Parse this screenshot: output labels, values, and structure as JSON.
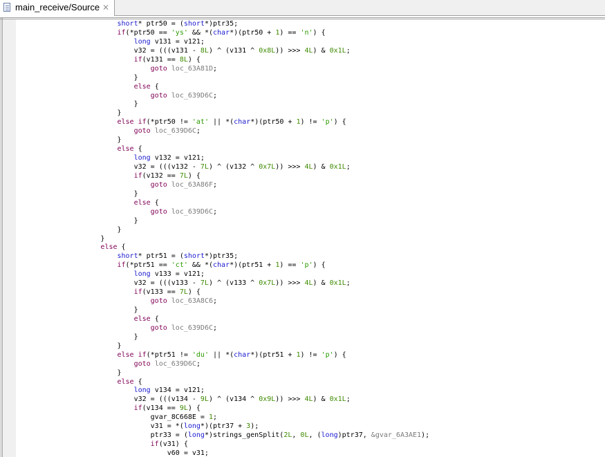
{
  "tab": {
    "title": "main_receive/Source",
    "icon": "source-file-icon",
    "close_icon": "close-icon"
  },
  "colors": {
    "keyword": "#7f0055",
    "type": "#1a1ad0",
    "string": "#2a9a00",
    "number": "#3d8a00",
    "label": "#7a7a7a"
  },
  "code_lines": [
    [
      [
        "p",
        "                        "
      ],
      [
        "t",
        "short"
      ],
      [
        "p",
        "* ptr50 = ("
      ],
      [
        "t",
        "short"
      ],
      [
        "p",
        "*)ptr35;"
      ]
    ],
    [
      [
        "p",
        "                        "
      ],
      [
        "k",
        "if"
      ],
      [
        "p",
        "(*ptr50 == "
      ],
      [
        "s",
        "'ys'"
      ],
      [
        "p",
        " && *("
      ],
      [
        "t",
        "char"
      ],
      [
        "p",
        "*)(ptr50 + "
      ],
      [
        "n",
        "1"
      ],
      [
        "p",
        ") == "
      ],
      [
        "s",
        "'n'"
      ],
      [
        "p",
        ") {"
      ]
    ],
    [
      [
        "p",
        "                            "
      ],
      [
        "t",
        "long"
      ],
      [
        "p",
        " v131 = v121;"
      ]
    ],
    [
      [
        "p",
        "                            v32 = (((v131 - "
      ],
      [
        "n",
        "8L"
      ],
      [
        "p",
        ") ^ (v131 ^ "
      ],
      [
        "n",
        "0x8L"
      ],
      [
        "p",
        ")) >>> "
      ],
      [
        "n",
        "4L"
      ],
      [
        "p",
        ") & "
      ],
      [
        "n",
        "0x1L"
      ],
      [
        "p",
        ";"
      ]
    ],
    [
      [
        "p",
        "                            "
      ],
      [
        "k",
        "if"
      ],
      [
        "p",
        "(v131 == "
      ],
      [
        "n",
        "8L"
      ],
      [
        "p",
        ") {"
      ]
    ],
    [
      [
        "p",
        "                                "
      ],
      [
        "k",
        "goto"
      ],
      [
        "p",
        " "
      ],
      [
        "l",
        "loc_63A81D"
      ],
      [
        "p",
        ";"
      ]
    ],
    [
      [
        "p",
        "                            }"
      ]
    ],
    [
      [
        "p",
        "                            "
      ],
      [
        "k",
        "else"
      ],
      [
        "p",
        " {"
      ]
    ],
    [
      [
        "p",
        "                                "
      ],
      [
        "k",
        "goto"
      ],
      [
        "p",
        " "
      ],
      [
        "l",
        "loc_639D6C"
      ],
      [
        "p",
        ";"
      ]
    ],
    [
      [
        "p",
        "                            }"
      ]
    ],
    [
      [
        "p",
        "                        }"
      ]
    ],
    [
      [
        "p",
        "                        "
      ],
      [
        "k",
        "else if"
      ],
      [
        "p",
        "(*ptr50 != "
      ],
      [
        "s",
        "'at'"
      ],
      [
        "p",
        " || *("
      ],
      [
        "t",
        "char"
      ],
      [
        "p",
        "*)(ptr50 + "
      ],
      [
        "n",
        "1"
      ],
      [
        "p",
        ") != "
      ],
      [
        "s",
        "'p'"
      ],
      [
        "p",
        ") {"
      ]
    ],
    [
      [
        "p",
        "                            "
      ],
      [
        "k",
        "goto"
      ],
      [
        "p",
        " "
      ],
      [
        "l",
        "loc_639D6C"
      ],
      [
        "p",
        ";"
      ]
    ],
    [
      [
        "p",
        "                        }"
      ]
    ],
    [
      [
        "p",
        "                        "
      ],
      [
        "k",
        "else"
      ],
      [
        "p",
        " {"
      ]
    ],
    [
      [
        "p",
        "                            "
      ],
      [
        "t",
        "long"
      ],
      [
        "p",
        " v132 = v121;"
      ]
    ],
    [
      [
        "p",
        "                            v32 = (((v132 - "
      ],
      [
        "n",
        "7L"
      ],
      [
        "p",
        ") ^ (v132 ^ "
      ],
      [
        "n",
        "0x7L"
      ],
      [
        "p",
        ")) >>> "
      ],
      [
        "n",
        "4L"
      ],
      [
        "p",
        ") & "
      ],
      [
        "n",
        "0x1L"
      ],
      [
        "p",
        ";"
      ]
    ],
    [
      [
        "p",
        "                            "
      ],
      [
        "k",
        "if"
      ],
      [
        "p",
        "(v132 == "
      ],
      [
        "n",
        "7L"
      ],
      [
        "p",
        ") {"
      ]
    ],
    [
      [
        "p",
        "                                "
      ],
      [
        "k",
        "goto"
      ],
      [
        "p",
        " "
      ],
      [
        "l",
        "loc_63A86F"
      ],
      [
        "p",
        ";"
      ]
    ],
    [
      [
        "p",
        "                            }"
      ]
    ],
    [
      [
        "p",
        "                            "
      ],
      [
        "k",
        "else"
      ],
      [
        "p",
        " {"
      ]
    ],
    [
      [
        "p",
        "                                "
      ],
      [
        "k",
        "goto"
      ],
      [
        "p",
        " "
      ],
      [
        "l",
        "loc_639D6C"
      ],
      [
        "p",
        ";"
      ]
    ],
    [
      [
        "p",
        "                            }"
      ]
    ],
    [
      [
        "p",
        "                        }"
      ]
    ],
    [
      [
        "p",
        "                    }"
      ]
    ],
    [
      [
        "p",
        "                    "
      ],
      [
        "k",
        "else"
      ],
      [
        "p",
        " {"
      ]
    ],
    [
      [
        "p",
        "                        "
      ],
      [
        "t",
        "short"
      ],
      [
        "p",
        "* ptr51 = ("
      ],
      [
        "t",
        "short"
      ],
      [
        "p",
        "*)ptr35;"
      ]
    ],
    [
      [
        "p",
        "                        "
      ],
      [
        "k",
        "if"
      ],
      [
        "p",
        "(*ptr51 == "
      ],
      [
        "s",
        "'ct'"
      ],
      [
        "p",
        " && *("
      ],
      [
        "t",
        "char"
      ],
      [
        "p",
        "*)(ptr51 + "
      ],
      [
        "n",
        "1"
      ],
      [
        "p",
        ") == "
      ],
      [
        "s",
        "'p'"
      ],
      [
        "p",
        ") {"
      ]
    ],
    [
      [
        "p",
        "                            "
      ],
      [
        "t",
        "long"
      ],
      [
        "p",
        " v133 = v121;"
      ]
    ],
    [
      [
        "p",
        "                            v32 = (((v133 - "
      ],
      [
        "n",
        "7L"
      ],
      [
        "p",
        ") ^ (v133 ^ "
      ],
      [
        "n",
        "0x7L"
      ],
      [
        "p",
        ")) >>> "
      ],
      [
        "n",
        "4L"
      ],
      [
        "p",
        ") & "
      ],
      [
        "n",
        "0x1L"
      ],
      [
        "p",
        ";"
      ]
    ],
    [
      [
        "p",
        "                            "
      ],
      [
        "k",
        "if"
      ],
      [
        "p",
        "(v133 == "
      ],
      [
        "n",
        "7L"
      ],
      [
        "p",
        ") {"
      ]
    ],
    [
      [
        "p",
        "                                "
      ],
      [
        "k",
        "goto"
      ],
      [
        "p",
        " "
      ],
      [
        "l",
        "loc_63A8C6"
      ],
      [
        "p",
        ";"
      ]
    ],
    [
      [
        "p",
        "                            }"
      ]
    ],
    [
      [
        "p",
        "                            "
      ],
      [
        "k",
        "else"
      ],
      [
        "p",
        " {"
      ]
    ],
    [
      [
        "p",
        "                                "
      ],
      [
        "k",
        "goto"
      ],
      [
        "p",
        " "
      ],
      [
        "l",
        "loc_639D6C"
      ],
      [
        "p",
        ";"
      ]
    ],
    [
      [
        "p",
        "                            }"
      ]
    ],
    [
      [
        "p",
        "                        }"
      ]
    ],
    [
      [
        "p",
        "                        "
      ],
      [
        "k",
        "else if"
      ],
      [
        "p",
        "(*ptr51 != "
      ],
      [
        "s",
        "'du'"
      ],
      [
        "p",
        " || *("
      ],
      [
        "t",
        "char"
      ],
      [
        "p",
        "*)(ptr51 + "
      ],
      [
        "n",
        "1"
      ],
      [
        "p",
        ") != "
      ],
      [
        "s",
        "'p'"
      ],
      [
        "p",
        ") {"
      ]
    ],
    [
      [
        "p",
        "                            "
      ],
      [
        "k",
        "goto"
      ],
      [
        "p",
        " "
      ],
      [
        "l",
        "loc_639D6C"
      ],
      [
        "p",
        ";"
      ]
    ],
    [
      [
        "p",
        "                        }"
      ]
    ],
    [
      [
        "p",
        "                        "
      ],
      [
        "k",
        "else"
      ],
      [
        "p",
        " {"
      ]
    ],
    [
      [
        "p",
        "                            "
      ],
      [
        "t",
        "long"
      ],
      [
        "p",
        " v134 = v121;"
      ]
    ],
    [
      [
        "p",
        "                            v32 = (((v134 - "
      ],
      [
        "n",
        "9L"
      ],
      [
        "p",
        ") ^ (v134 ^ "
      ],
      [
        "n",
        "0x9L"
      ],
      [
        "p",
        ")) >>> "
      ],
      [
        "n",
        "4L"
      ],
      [
        "p",
        ") & "
      ],
      [
        "n",
        "0x1L"
      ],
      [
        "p",
        ";"
      ]
    ],
    [
      [
        "p",
        "                            "
      ],
      [
        "k",
        "if"
      ],
      [
        "p",
        "(v134 == "
      ],
      [
        "n",
        "9L"
      ],
      [
        "p",
        ") {"
      ]
    ],
    [
      [
        "p",
        "                                gvar_8C668E = "
      ],
      [
        "n",
        "1"
      ],
      [
        "p",
        ";"
      ]
    ],
    [
      [
        "p",
        "                                v31 = *("
      ],
      [
        "t",
        "long"
      ],
      [
        "p",
        "*)(ptr37 + "
      ],
      [
        "n",
        "3"
      ],
      [
        "p",
        ");"
      ]
    ],
    [
      [
        "p",
        "                                ptr33 = ("
      ],
      [
        "t",
        "long"
      ],
      [
        "p",
        "*)strings_genSplit("
      ],
      [
        "n",
        "2L"
      ],
      [
        "p",
        ", "
      ],
      [
        "n",
        "0L"
      ],
      [
        "p",
        ", ("
      ],
      [
        "t",
        "long"
      ],
      [
        "p",
        ")ptr37, "
      ],
      [
        "l",
        "&gvar_6A3AE1"
      ],
      [
        "p",
        ");"
      ]
    ],
    [
      [
        "p",
        "                                "
      ],
      [
        "k",
        "if"
      ],
      [
        "p",
        "(v31) {"
      ]
    ],
    [
      [
        "p",
        "                                    v60 = v31;"
      ]
    ]
  ]
}
